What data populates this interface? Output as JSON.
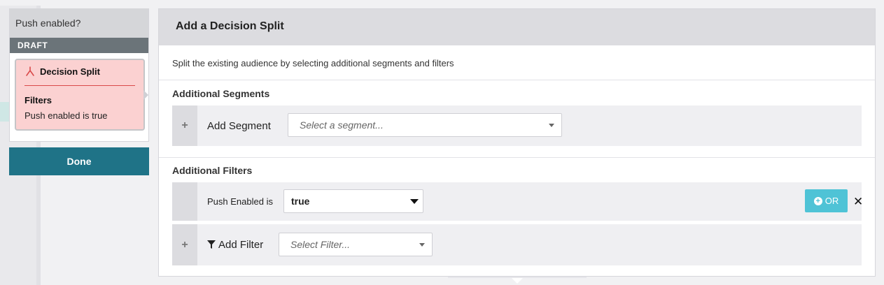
{
  "node": {
    "title": "Push enabled?",
    "status": "DRAFT",
    "card_title": "Decision Split",
    "filters_label": "Filters",
    "filter_text": "Push enabled is true",
    "done_label": "Done"
  },
  "modal": {
    "title": "Add a Decision Split",
    "description": "Split the existing audience by selecting additional segments and filters",
    "segments_section": "Additional Segments",
    "add_segment_label": "Add Segment",
    "segment_placeholder": "Select a segment...",
    "filters_section": "Additional Filters",
    "filter_row_label": "Push Enabled is",
    "filter_value": "true",
    "or_label": "OR",
    "add_filter_label": "Add Filter",
    "filter_placeholder": "Select Filter..."
  },
  "colors": {
    "accent": "#1f7387",
    "or_button": "#4fc3d6",
    "card_bg": "#fbd1d1",
    "card_rule": "#d94a4a",
    "status_bar": "#6b7479"
  },
  "icons": [
    "split-icon",
    "plus-icon",
    "filter-icon",
    "close-icon",
    "chevron-down-icon"
  ]
}
